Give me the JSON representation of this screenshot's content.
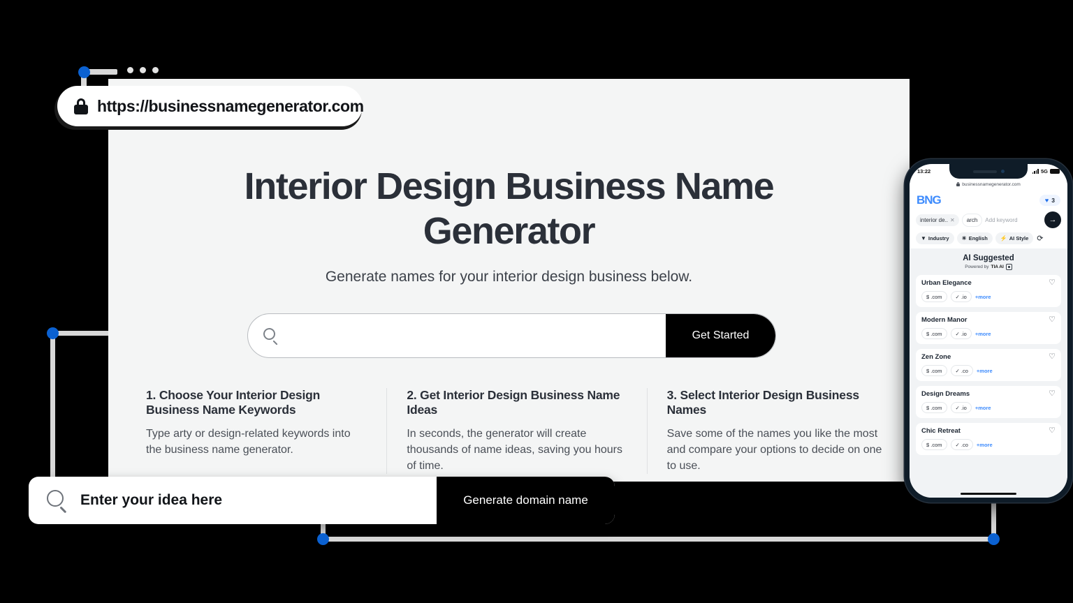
{
  "browser": {
    "url": "https://businessnamegenerator.com",
    "window_dots": [
      "dot-1",
      "dot-2",
      "dot-3"
    ],
    "lock_icon": "lock-icon"
  },
  "hero": {
    "title": "Interior Design Business Name Generator",
    "subtitle": "Generate names for your interior design business below.",
    "search_placeholder": "",
    "search_value": "",
    "search_icon": "search-icon",
    "cta_label": "Get Started"
  },
  "features": [
    {
      "heading": "1. Choose Your Interior Design Business Name Keywords",
      "body": "Type arty or design-related keywords into the business name generator."
    },
    {
      "heading": "2. Get Interior Design Business Name Ideas",
      "body": "In seconds, the generator will create thousands of name ideas, saving you hours of time."
    },
    {
      "heading": "3. Select Interior Design Business Names",
      "body": "Save some of the names you like the most and compare your options to decide on one to use."
    }
  ],
  "idea_bar": {
    "placeholder": "Enter your idea here",
    "value": "",
    "search_icon": "search-icon",
    "button_label": "Generate domain name"
  },
  "phone": {
    "status": {
      "time": "13:22",
      "network": "5G",
      "signal_icon": "signal-bars-icon",
      "battery_icon": "battery-icon"
    },
    "url": "businessnamegenerator.com",
    "logo": "BNG",
    "favorites_count": "3",
    "favorites_icon": "heart-icon",
    "keyword_chips": [
      {
        "label": "interior de..",
        "remove_icon": "close-icon"
      },
      {
        "label": "arch",
        "remove_icon": "close-icon"
      }
    ],
    "keyword_placeholder": "Add keyword",
    "submit_icon": "arrow-right-icon",
    "filters": [
      {
        "label": "Industry",
        "icon": "filter-icon",
        "glyph": "▼"
      },
      {
        "label": "English",
        "icon": "globe-icon",
        "glyph": "⊕"
      },
      {
        "label": "AI Style",
        "icon": "bolt-icon",
        "glyph": "⚡"
      }
    ],
    "refresh_icon": "refresh-icon",
    "results_title": "AI Suggested",
    "results_subtitle_prefix": "Powered by",
    "results_subtitle_brand": "TIA AI",
    "results_subtitle_icon": "chip-icon",
    "results": [
      {
        "name": "Urban Elegance",
        "domains": [
          "$ .com",
          "✓ .io"
        ],
        "more": "+more",
        "fav_icon": "heart-outline-icon"
      },
      {
        "name": "Modern Manor",
        "domains": [
          "$ .com",
          "✓ .io"
        ],
        "more": "+more",
        "fav_icon": "heart-outline-icon"
      },
      {
        "name": "Zen Zone",
        "domains": [
          "$ .com",
          "✓ .co"
        ],
        "more": "+more",
        "fav_icon": "heart-outline-icon"
      },
      {
        "name": "Design Dreams",
        "domains": [
          "$ .com",
          "✓ .io"
        ],
        "more": "+more",
        "fav_icon": "heart-outline-icon"
      },
      {
        "name": "Chic Retreat",
        "domains": [
          "$ .com",
          "✓ .co"
        ],
        "more": "+more",
        "fav_icon": "heart-outline-icon"
      }
    ]
  },
  "colors": {
    "accent_blue": "#0b61d1",
    "logo_blue": "#3d8bfd",
    "page_bg": "#f4f5f5",
    "heading": "#2b3039",
    "black": "#000000",
    "green": "#1db954"
  }
}
